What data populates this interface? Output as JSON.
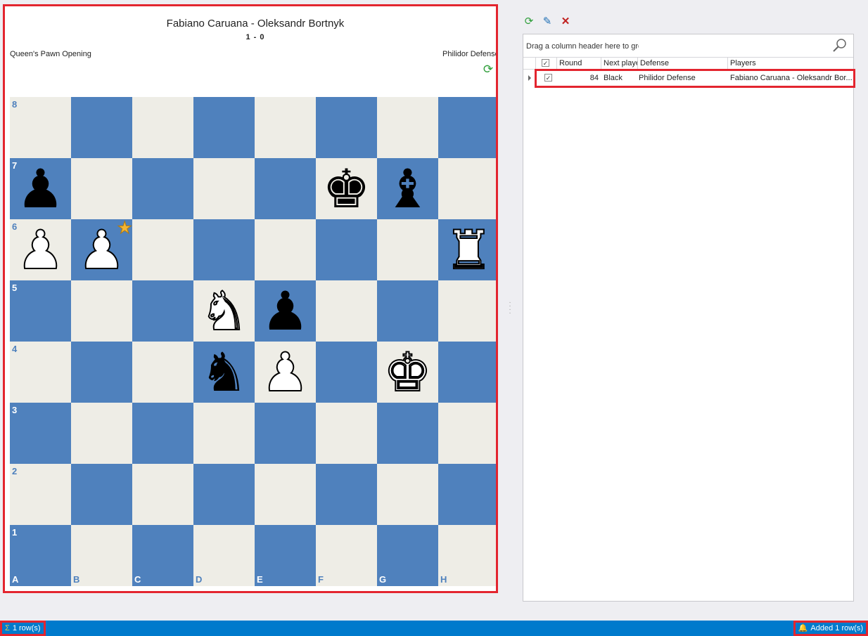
{
  "game": {
    "title": "Fabiano Caruana - Oleksandr Bortnyk",
    "result": "1 - 0",
    "opening": "Queen's Pawn Opening",
    "defense": "Philidor Defense"
  },
  "board": {
    "ranks": [
      "8",
      "7",
      "6",
      "5",
      "4",
      "3",
      "2",
      "1"
    ],
    "files": [
      "A",
      "B",
      "C",
      "D",
      "E",
      "F",
      "G",
      "H"
    ],
    "pieces": [
      {
        "square": "a7",
        "color": "black",
        "type": "pawn"
      },
      {
        "square": "f7",
        "color": "black",
        "type": "king"
      },
      {
        "square": "g7",
        "color": "black",
        "type": "bishop"
      },
      {
        "square": "a6",
        "color": "white",
        "type": "pawn"
      },
      {
        "square": "b6",
        "color": "white",
        "type": "pawn",
        "marker": "star"
      },
      {
        "square": "h6",
        "color": "white",
        "type": "rook"
      },
      {
        "square": "d5",
        "color": "white",
        "type": "knight"
      },
      {
        "square": "e5",
        "color": "black",
        "type": "pawn"
      },
      {
        "square": "d4",
        "color": "black",
        "type": "knight"
      },
      {
        "square": "e4",
        "color": "white",
        "type": "pawn"
      },
      {
        "square": "g4",
        "color": "white",
        "type": "king"
      }
    ]
  },
  "grid": {
    "group_hint": "Drag a column header here to group by that column",
    "columns": {
      "round": "Round",
      "next_player": "Next player",
      "defense": "Defense",
      "players": "Players"
    },
    "rows": [
      {
        "checked": true,
        "round": "84",
        "next_player": "Black",
        "defense": "Philidor Defense",
        "players": "Fabiano Caruana - Oleksandr Bor..."
      }
    ]
  },
  "status": {
    "row_count": "1 row(s)",
    "notification": "Added 1 row(s)"
  },
  "colors": {
    "light_square": "#eeede6",
    "dark_square": "#4f81bd",
    "highlight": "#e3252f",
    "status_bar": "#007acc"
  }
}
